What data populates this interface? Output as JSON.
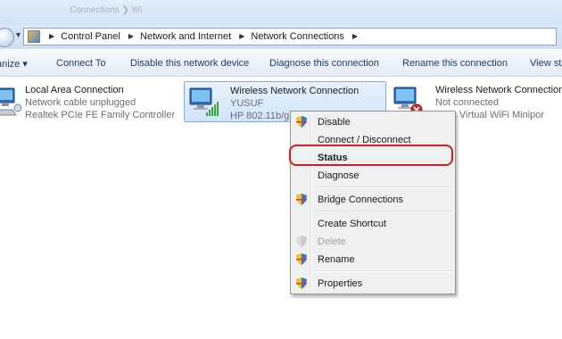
{
  "window": {
    "faded_title": "Connections ❯ Wi"
  },
  "address": {
    "crumbs": [
      "Control Panel",
      "Network and Internet",
      "Network Connections"
    ]
  },
  "toolbar": {
    "organize": "anize ▾",
    "connect_to": "Connect To",
    "disable_device": "Disable this network device",
    "diagnose": "Diagnose this connection",
    "rename": "Rename this connection",
    "view_status": "View sta"
  },
  "connections": [
    {
      "name": "Local Area Connection",
      "status": "Network cable unplugged",
      "adapter": "Realtek PCIe FE Family Controller"
    },
    {
      "name": "Wireless Network Connection",
      "status": "YUSUF",
      "adapter": "HP 802.11b/g"
    },
    {
      "name": "Wireless Network Connection",
      "status": "Not connected",
      "adapter": "osoft Virtual WiFi Minipor"
    }
  ],
  "context_menu": {
    "items": [
      {
        "label": "Disable",
        "shield": true,
        "bold": false,
        "enabled": true
      },
      {
        "label": "Connect / Disconnect",
        "shield": false,
        "bold": false,
        "enabled": true
      },
      {
        "label": "Status",
        "shield": false,
        "bold": true,
        "enabled": true
      },
      {
        "label": "Diagnose",
        "shield": false,
        "bold": false,
        "enabled": true
      },
      {
        "label": "Bridge Connections",
        "shield": true,
        "bold": false,
        "enabled": true
      },
      {
        "label": "Create Shortcut",
        "shield": false,
        "bold": false,
        "enabled": true
      },
      {
        "label": "Delete",
        "shield": true,
        "bold": false,
        "enabled": false
      },
      {
        "label": "Rename",
        "shield": true,
        "bold": false,
        "enabled": true
      },
      {
        "label": "Properties",
        "shield": true,
        "bold": false,
        "enabled": true
      }
    ]
  },
  "colors": {
    "highlight_ring": "#d02020",
    "toolbar_text": "#1e3c66",
    "selection_border": "#84acdd"
  }
}
